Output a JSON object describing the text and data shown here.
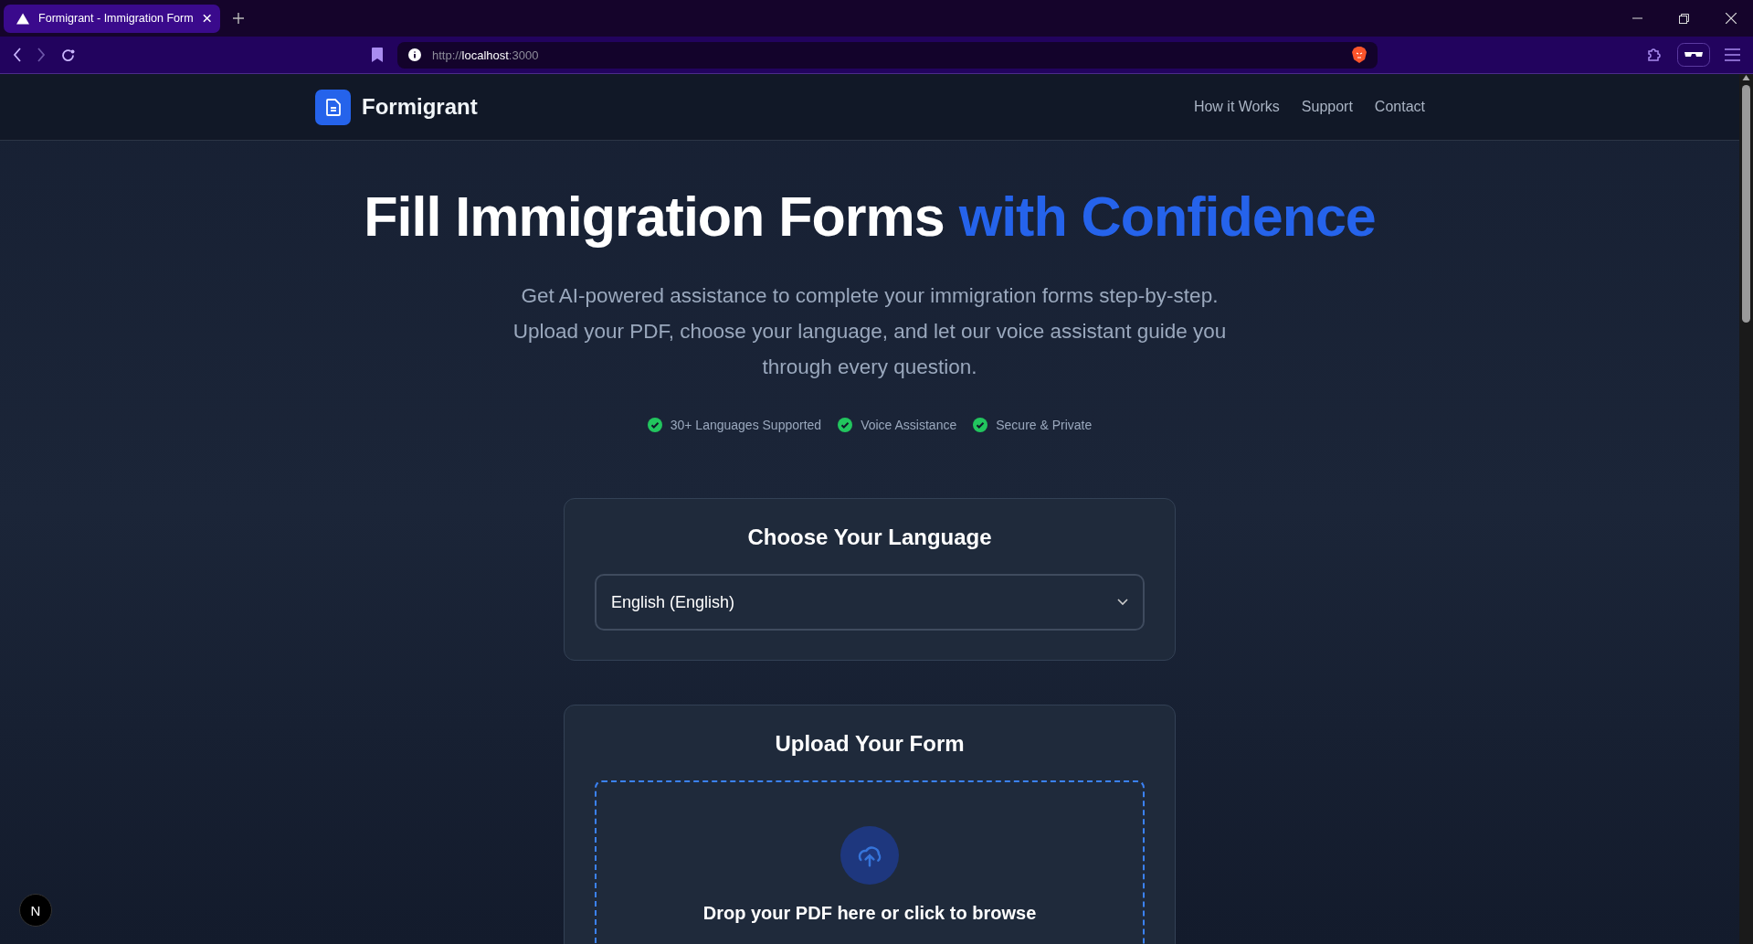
{
  "browser": {
    "tab": {
      "title": "Formigrant - Immigration Form",
      "selected": true
    },
    "url": {
      "scheme": "http://",
      "host": "localhost",
      "port": ":3000"
    }
  },
  "header": {
    "brand": "Formigrant",
    "nav": [
      "How it Works",
      "Support",
      "Contact"
    ]
  },
  "hero": {
    "title": "Fill Immigration Forms ",
    "title_accent": "with Confidence",
    "subtitle": "Get AI-powered assistance to complete your immigration forms step-by-step. Upload your PDF, choose your language, and let our voice assistant guide you through every question.",
    "features": [
      "30+ Languages Supported",
      "Voice Assistance",
      "Secure & Private"
    ]
  },
  "language_card": {
    "title": "Choose Your Language",
    "value": "English (English)"
  },
  "upload_card": {
    "title": "Upload Your Form",
    "prompt": "Drop your PDF here or click to browse"
  },
  "dev_badge": "N"
}
